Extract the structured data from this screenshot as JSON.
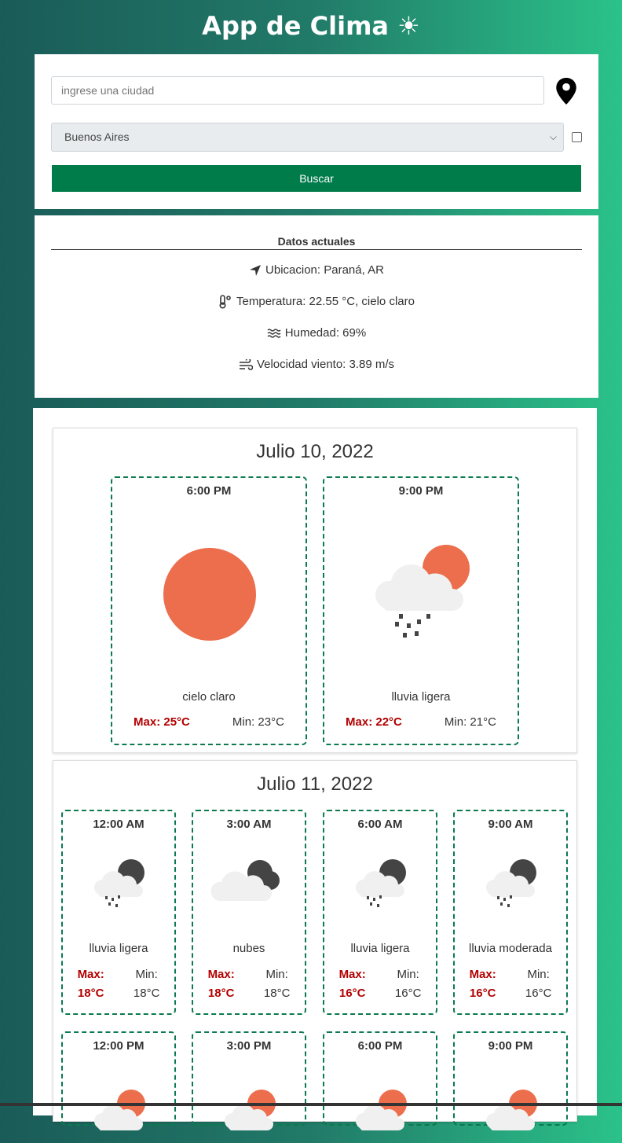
{
  "app": {
    "title": "App de Clima ☀"
  },
  "search": {
    "placeholder": "ingrese una ciudad",
    "selected_city": "Buenos Aires",
    "button": "Buscar"
  },
  "current": {
    "heading": "Datos actuales",
    "location": "Ubicacion: Paraná, AR",
    "temperature": "Temperatura: 22.55 °C, cielo claro",
    "humidity": "Humedad: 69%",
    "wind": "Velocidad viento: 3.89 m/s"
  },
  "days": [
    {
      "date": "Julio 10, 2022",
      "slots": [
        {
          "time": "6:00 PM",
          "icon": "sun-icon",
          "desc": "cielo claro",
          "max": "Max: 25°C",
          "min": "Min: 23°C"
        },
        {
          "time": "9:00 PM",
          "icon": "sun-cloud-rain-icon",
          "desc": "lluvia ligera",
          "max": "Max: 22°C",
          "min": "Min: 21°C"
        }
      ]
    },
    {
      "date": "Julio 11, 2022",
      "slots": [
        {
          "time": "12:00 AM",
          "icon": "moon-cloud-rain-icon",
          "desc": "lluvia ligera",
          "max_label": "Max:",
          "max": "18°C",
          "min_label": "Min:",
          "min": "18°C"
        },
        {
          "time": "3:00 AM",
          "icon": "moon-cloud-icon",
          "desc": "nubes",
          "max_label": "Max:",
          "max": "18°C",
          "min_label": "Min:",
          "min": "18°C"
        },
        {
          "time": "6:00 AM",
          "icon": "moon-cloud-rain-icon",
          "desc": "lluvia ligera",
          "max_label": "Max:",
          "max": "16°C",
          "min_label": "Min:",
          "min": "16°C"
        },
        {
          "time": "9:00 AM",
          "icon": "moon-cloud-rain-icon",
          "desc": "lluvia moderada",
          "max_label": "Max:",
          "max": "16°C",
          "min_label": "Min:",
          "min": "16°C"
        },
        {
          "time": "12:00 PM",
          "icon": "sun-cloud-icon"
        },
        {
          "time": "3:00 PM",
          "icon": "sun-cloud-icon"
        },
        {
          "time": "6:00 PM",
          "icon": "sun-cloud-icon"
        },
        {
          "time": "9:00 PM",
          "icon": "sun-cloud-icon"
        }
      ]
    }
  ]
}
